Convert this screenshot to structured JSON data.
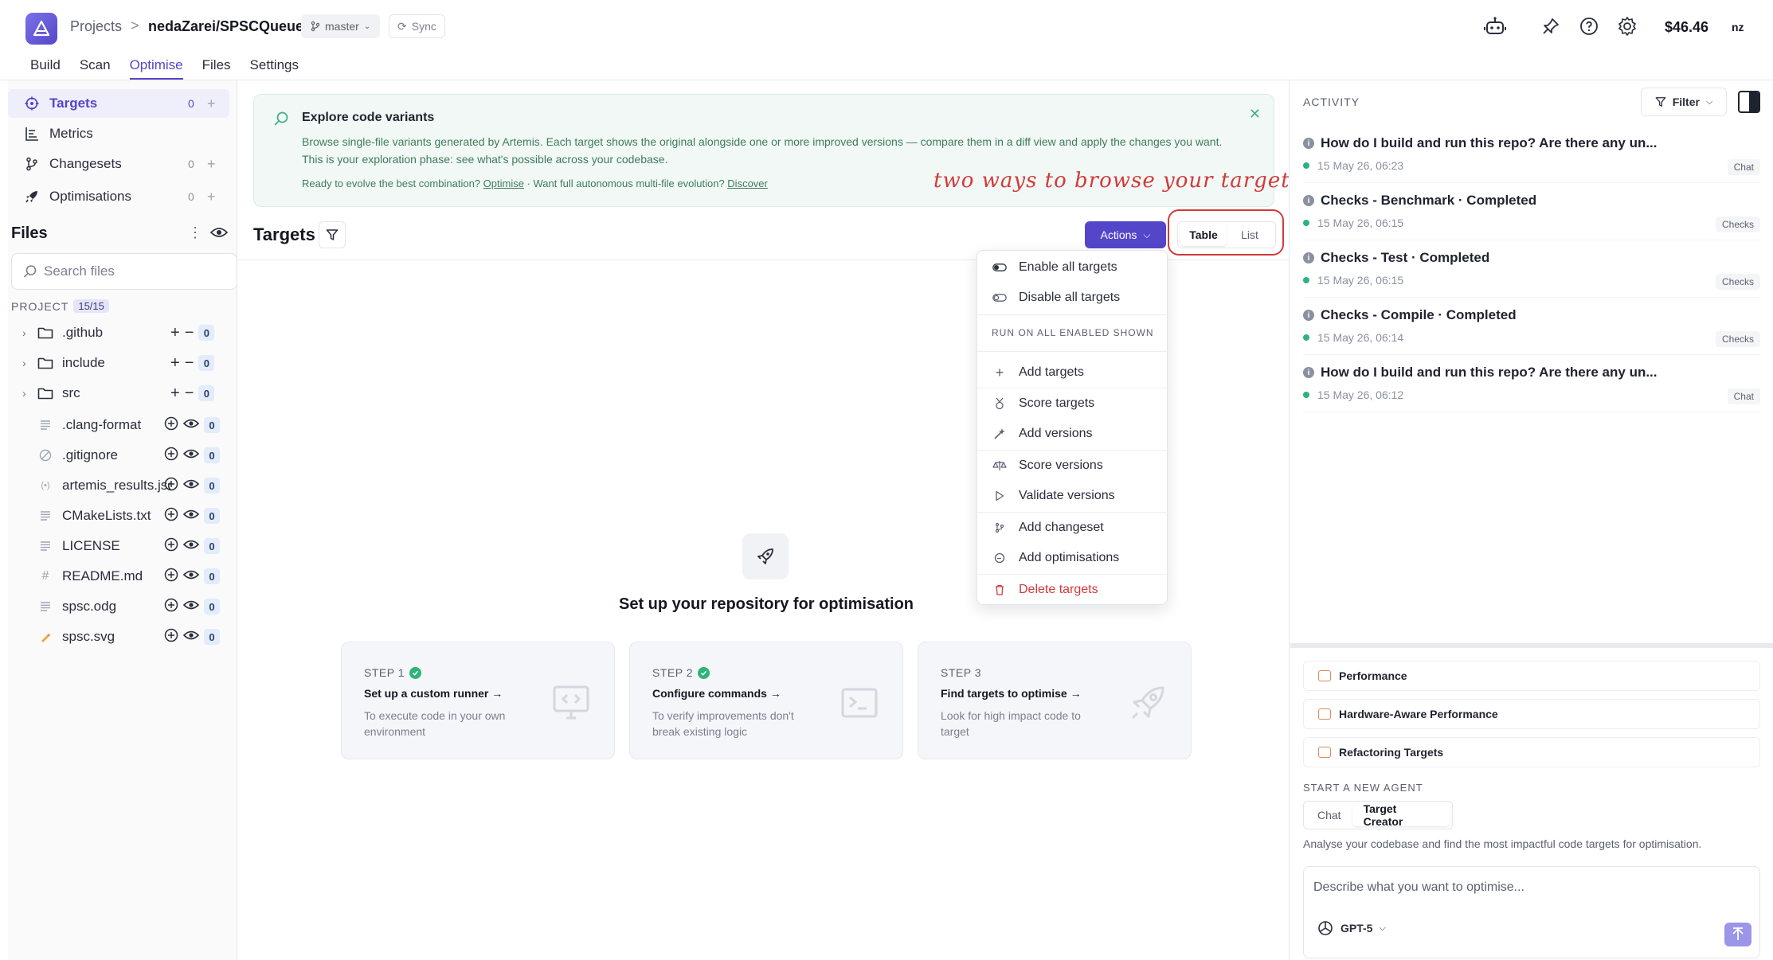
{
  "header": {
    "crumb_projects": "Projects",
    "crumb_sep": ">",
    "repo": "nedaZarei/SPSCQueue",
    "branch": "master",
    "sync": "Sync",
    "credits": "$46.46",
    "user_initials": "nz"
  },
  "tabs": [
    "Build",
    "Scan",
    "Optimise",
    "Files",
    "Settings"
  ],
  "active_tab": "Optimise",
  "sidebar": {
    "nav": [
      {
        "label": "Targets",
        "count": "0",
        "icon": "target-icon",
        "active": true
      },
      {
        "label": "Metrics",
        "icon": "metrics-icon"
      },
      {
        "label": "Changesets",
        "count": "0",
        "icon": "branch-icon"
      },
      {
        "label": "Optimisations",
        "count": "0",
        "icon": "rocket-icon"
      }
    ],
    "plus": "+",
    "files_title": "Files",
    "search_placeholder": "Search files",
    "project_label": "PROJECT",
    "project_count": "15/15",
    "folders": [
      {
        "name": ".github",
        "count": "0"
      },
      {
        "name": "include",
        "count": "0"
      },
      {
        "name": "src",
        "count": "0"
      }
    ],
    "files": [
      {
        "name": ".clang-format",
        "count": "0",
        "icon": "text-file-icon"
      },
      {
        "name": ".gitignore",
        "count": "0",
        "icon": "ignore-file-icon"
      },
      {
        "name": "artemis_results.json",
        "count": "0",
        "icon": "json-file-icon"
      },
      {
        "name": "CMakeLists.txt",
        "count": "0",
        "icon": "text-file-icon"
      },
      {
        "name": "LICENSE",
        "count": "0",
        "icon": "text-file-icon"
      },
      {
        "name": "README.md",
        "count": "0",
        "icon": "hash-icon"
      },
      {
        "name": "spsc.odg",
        "count": "0",
        "icon": "text-file-icon"
      },
      {
        "name": "spsc.svg",
        "count": "0",
        "icon": "svg-file-icon"
      }
    ]
  },
  "banner": {
    "title": "Explore code variants",
    "text": "Browse single-file variants generated by Artemis. Each target shows the original alongside one or more improved versions — compare them in a diff view and apply the changes you want. This is your exploration phase: see what's possible across your codebase.",
    "sub_prefix": "Ready to evolve the best combination?",
    "sub_link1": "Optimise",
    "sub_mid": "· Want full autonomous multi-file evolution?",
    "sub_link2": "Discover"
  },
  "annotation": "two ways to browse your targets",
  "targets": {
    "title": "Targets",
    "actions_label": "Actions",
    "view_table": "Table",
    "view_list": "List"
  },
  "menu": {
    "enable_all": "Enable all targets",
    "disable_all": "Disable all targets",
    "heading": "RUN ON ALL ENABLED SHOWN",
    "items": [
      {
        "label": "Add targets",
        "icon": "plus-icon"
      },
      {
        "label": "Score targets",
        "icon": "medal-icon"
      },
      {
        "label": "Add versions",
        "icon": "wand-icon"
      },
      {
        "label": "Score versions",
        "icon": "scale-icon"
      },
      {
        "label": "Validate versions",
        "icon": "play-icon"
      },
      {
        "label": "Add changeset",
        "icon": "branch-icon"
      },
      {
        "label": "Add optimisations",
        "icon": "gauge-icon"
      }
    ],
    "delete": "Delete targets"
  },
  "empty_state": {
    "title": "Set up your repository for optimisation",
    "steps": [
      {
        "label": "STEP 1",
        "done": true,
        "title": "Set up a custom runner →",
        "desc": "To execute code in your own environment"
      },
      {
        "label": "STEP 2",
        "done": true,
        "title": "Configure commands →",
        "desc": "To verify improvements don't break existing logic"
      },
      {
        "label": "STEP 3",
        "done": false,
        "title": "Find targets to optimise →",
        "desc": "Look for high impact code to target"
      }
    ]
  },
  "activity": {
    "label": "ACTIVITY",
    "filter": "Filter",
    "items": [
      {
        "title": "How do I build and run this repo? Are there any un...",
        "time": "15 May 26, 06:23",
        "tag": "Chat"
      },
      {
        "title": "Checks - Benchmark · Completed",
        "time": "15 May 26, 06:15",
        "tag": "Checks"
      },
      {
        "title": "Checks - Test · Completed",
        "time": "15 May 26, 06:15",
        "tag": "Checks"
      },
      {
        "title": "Checks - Compile · Completed",
        "time": "15 May 26, 06:14",
        "tag": "Checks"
      },
      {
        "title": "How do I build and run this repo? Are there any un...",
        "time": "15 May 26, 06:12",
        "tag": "Chat"
      }
    ]
  },
  "agents": {
    "items": [
      "Performance",
      "Hardware-Aware Performance",
      "Refactoring Targets"
    ],
    "start_label": "START A NEW AGENT",
    "tab_chat": "Chat",
    "tab_target_creator": "Target Creator",
    "description": "Analyse your codebase and find the most impactful code targets for optimisation.",
    "prompt_placeholder": "Describe what you want to optimise...",
    "model": "GPT-5"
  },
  "colors": {
    "accent": "#5446c9",
    "success": "#2fb37a",
    "danger": "#d23a3a",
    "banner_bg": "#f2f8f5"
  }
}
